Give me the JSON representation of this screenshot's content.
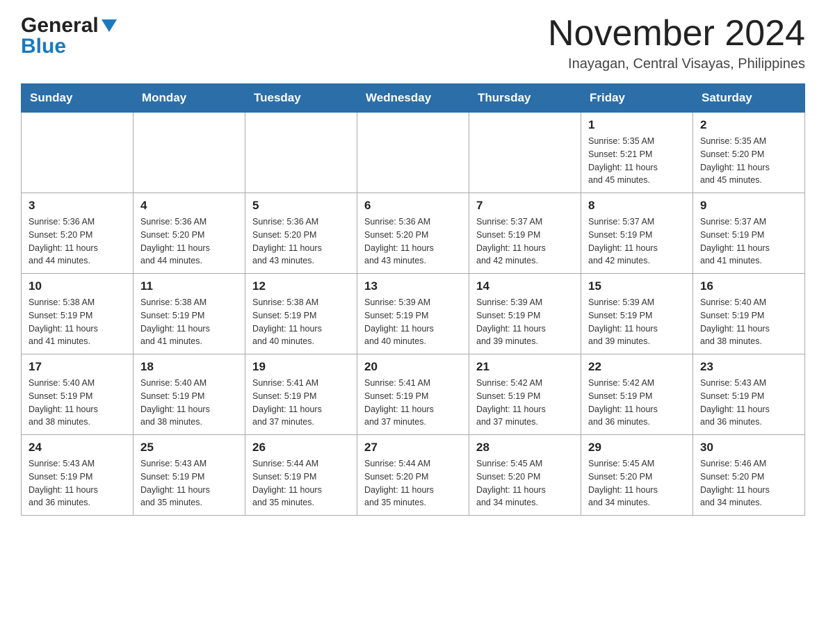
{
  "header": {
    "logo": {
      "general": "General",
      "blue": "Blue"
    },
    "title": "November 2024",
    "location": "Inayagan, Central Visayas, Philippines"
  },
  "days_of_week": [
    "Sunday",
    "Monday",
    "Tuesday",
    "Wednesday",
    "Thursday",
    "Friday",
    "Saturday"
  ],
  "weeks": [
    [
      {
        "day": "",
        "info": ""
      },
      {
        "day": "",
        "info": ""
      },
      {
        "day": "",
        "info": ""
      },
      {
        "day": "",
        "info": ""
      },
      {
        "day": "",
        "info": ""
      },
      {
        "day": "1",
        "info": "Sunrise: 5:35 AM\nSunset: 5:21 PM\nDaylight: 11 hours\nand 45 minutes."
      },
      {
        "day": "2",
        "info": "Sunrise: 5:35 AM\nSunset: 5:20 PM\nDaylight: 11 hours\nand 45 minutes."
      }
    ],
    [
      {
        "day": "3",
        "info": "Sunrise: 5:36 AM\nSunset: 5:20 PM\nDaylight: 11 hours\nand 44 minutes."
      },
      {
        "day": "4",
        "info": "Sunrise: 5:36 AM\nSunset: 5:20 PM\nDaylight: 11 hours\nand 44 minutes."
      },
      {
        "day": "5",
        "info": "Sunrise: 5:36 AM\nSunset: 5:20 PM\nDaylight: 11 hours\nand 43 minutes."
      },
      {
        "day": "6",
        "info": "Sunrise: 5:36 AM\nSunset: 5:20 PM\nDaylight: 11 hours\nand 43 minutes."
      },
      {
        "day": "7",
        "info": "Sunrise: 5:37 AM\nSunset: 5:19 PM\nDaylight: 11 hours\nand 42 minutes."
      },
      {
        "day": "8",
        "info": "Sunrise: 5:37 AM\nSunset: 5:19 PM\nDaylight: 11 hours\nand 42 minutes."
      },
      {
        "day": "9",
        "info": "Sunrise: 5:37 AM\nSunset: 5:19 PM\nDaylight: 11 hours\nand 41 minutes."
      }
    ],
    [
      {
        "day": "10",
        "info": "Sunrise: 5:38 AM\nSunset: 5:19 PM\nDaylight: 11 hours\nand 41 minutes."
      },
      {
        "day": "11",
        "info": "Sunrise: 5:38 AM\nSunset: 5:19 PM\nDaylight: 11 hours\nand 41 minutes."
      },
      {
        "day": "12",
        "info": "Sunrise: 5:38 AM\nSunset: 5:19 PM\nDaylight: 11 hours\nand 40 minutes."
      },
      {
        "day": "13",
        "info": "Sunrise: 5:39 AM\nSunset: 5:19 PM\nDaylight: 11 hours\nand 40 minutes."
      },
      {
        "day": "14",
        "info": "Sunrise: 5:39 AM\nSunset: 5:19 PM\nDaylight: 11 hours\nand 39 minutes."
      },
      {
        "day": "15",
        "info": "Sunrise: 5:39 AM\nSunset: 5:19 PM\nDaylight: 11 hours\nand 39 minutes."
      },
      {
        "day": "16",
        "info": "Sunrise: 5:40 AM\nSunset: 5:19 PM\nDaylight: 11 hours\nand 38 minutes."
      }
    ],
    [
      {
        "day": "17",
        "info": "Sunrise: 5:40 AM\nSunset: 5:19 PM\nDaylight: 11 hours\nand 38 minutes."
      },
      {
        "day": "18",
        "info": "Sunrise: 5:40 AM\nSunset: 5:19 PM\nDaylight: 11 hours\nand 38 minutes."
      },
      {
        "day": "19",
        "info": "Sunrise: 5:41 AM\nSunset: 5:19 PM\nDaylight: 11 hours\nand 37 minutes."
      },
      {
        "day": "20",
        "info": "Sunrise: 5:41 AM\nSunset: 5:19 PM\nDaylight: 11 hours\nand 37 minutes."
      },
      {
        "day": "21",
        "info": "Sunrise: 5:42 AM\nSunset: 5:19 PM\nDaylight: 11 hours\nand 37 minutes."
      },
      {
        "day": "22",
        "info": "Sunrise: 5:42 AM\nSunset: 5:19 PM\nDaylight: 11 hours\nand 36 minutes."
      },
      {
        "day": "23",
        "info": "Sunrise: 5:43 AM\nSunset: 5:19 PM\nDaylight: 11 hours\nand 36 minutes."
      }
    ],
    [
      {
        "day": "24",
        "info": "Sunrise: 5:43 AM\nSunset: 5:19 PM\nDaylight: 11 hours\nand 36 minutes."
      },
      {
        "day": "25",
        "info": "Sunrise: 5:43 AM\nSunset: 5:19 PM\nDaylight: 11 hours\nand 35 minutes."
      },
      {
        "day": "26",
        "info": "Sunrise: 5:44 AM\nSunset: 5:19 PM\nDaylight: 11 hours\nand 35 minutes."
      },
      {
        "day": "27",
        "info": "Sunrise: 5:44 AM\nSunset: 5:20 PM\nDaylight: 11 hours\nand 35 minutes."
      },
      {
        "day": "28",
        "info": "Sunrise: 5:45 AM\nSunset: 5:20 PM\nDaylight: 11 hours\nand 34 minutes."
      },
      {
        "day": "29",
        "info": "Sunrise: 5:45 AM\nSunset: 5:20 PM\nDaylight: 11 hours\nand 34 minutes."
      },
      {
        "day": "30",
        "info": "Sunrise: 5:46 AM\nSunset: 5:20 PM\nDaylight: 11 hours\nand 34 minutes."
      }
    ]
  ]
}
